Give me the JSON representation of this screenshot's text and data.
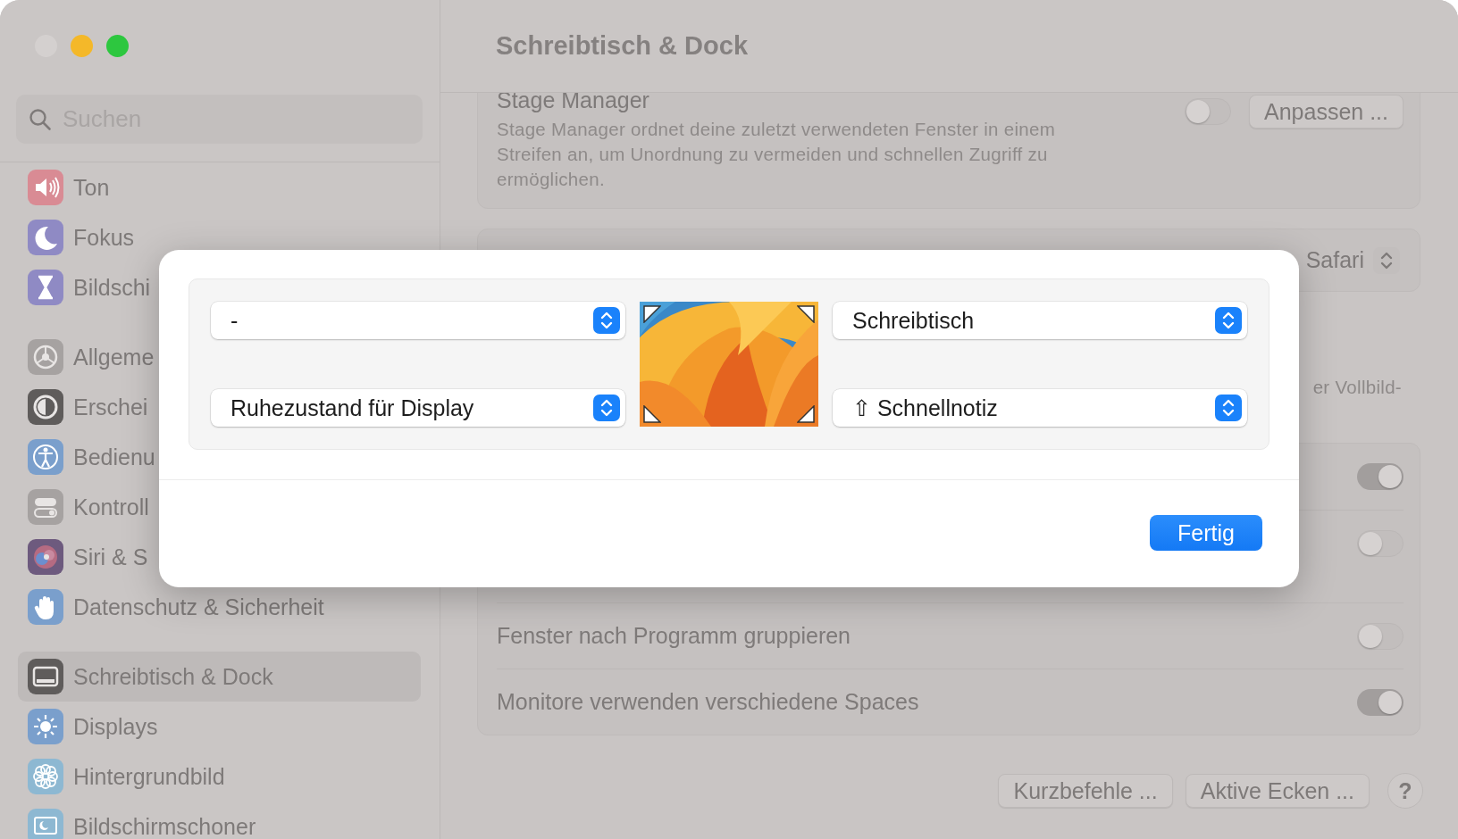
{
  "window": {
    "controls": [
      {
        "kind": "close"
      },
      {
        "kind": "minimize"
      },
      {
        "kind": "zoom"
      }
    ]
  },
  "sidebar": {
    "search": {
      "placeholder": "Suchen"
    },
    "groups": [
      {
        "items": [
          {
            "label": "Ton",
            "kind": "speaker",
            "selected": false
          },
          {
            "label": "Fokus",
            "kind": "moon",
            "selected": false
          },
          {
            "label": "Bildschi",
            "kind": "hourglass",
            "selected": false
          }
        ]
      },
      {
        "items": [
          {
            "label": "Allgeme",
            "kind": "gear",
            "selected": false
          },
          {
            "label": "Erschei",
            "kind": "contrast",
            "selected": false
          },
          {
            "label": "Bedienu",
            "kind": "person",
            "selected": false
          },
          {
            "label": "Kontroll",
            "kind": "switches",
            "selected": false
          },
          {
            "label": "Siri & S",
            "kind": "orb",
            "selected": false
          },
          {
            "label": "Datenschutz & Sicherheit",
            "kind": "hand",
            "selected": false
          }
        ]
      },
      {
        "items": [
          {
            "label": "Schreibtisch & Dock",
            "kind": "dock",
            "selected": true
          },
          {
            "label": "Displays",
            "kind": "sun",
            "selected": false
          },
          {
            "label": "Hintergrundbild",
            "kind": "flower",
            "selected": false
          },
          {
            "label": "Bildschirmschoner",
            "kind": "screen",
            "selected": false
          }
        ]
      }
    ]
  },
  "header": {
    "title": "Schreibtisch & Dock"
  },
  "stage_manager": {
    "title": "Stage Manager",
    "description": "Stage Manager ordnet deine zuletzt verwendeten Fenster in einem Streifen an, um Unordnung zu vermeiden und schnellen Zugriff zu ermöglichen.",
    "on": false,
    "button": "Anpassen ..."
  },
  "browser": {
    "value": "Safari"
  },
  "fragment": "er Vollbild-",
  "toggle_rows": [
    {
      "kind": "plain",
      "on": true
    },
    {
      "kind": "described",
      "on": false
    },
    {
      "kind": "plain",
      "label": "Fenster nach Programm gruppieren",
      "on": false
    },
    {
      "kind": "plain",
      "label": "Monitore verwenden verschiedene Spaces",
      "on": true
    }
  ],
  "footer": {
    "buttons": [
      "Kurzbefehle ...",
      "Aktive Ecken ..."
    ],
    "help": "?"
  },
  "sheet": {
    "corners": [
      {
        "value": "-"
      },
      {
        "value": "Schreibtisch"
      },
      {
        "value": "Ruhezustand für Display"
      },
      {
        "modifier": "⇧",
        "value": "Schnellnotiz"
      }
    ],
    "done": "Fertig"
  }
}
